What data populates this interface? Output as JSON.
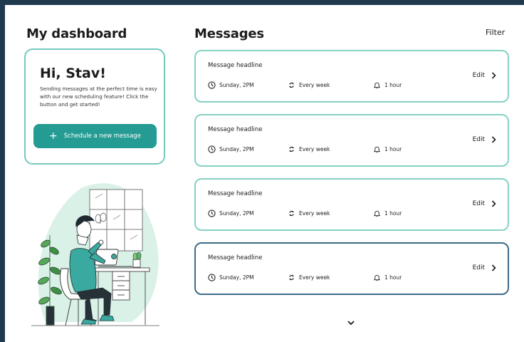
{
  "header": {
    "title": "My dashboard",
    "messages_title": "Messages",
    "filter_label": "Filter"
  },
  "welcome": {
    "greeting": "Hi, Stav!",
    "description": "Sending messages at the perfect time is easy with our new scheduling feature! Click the button and get started!",
    "button_label": "Schedule a new message",
    "button_icon": "plus-icon"
  },
  "messages": [
    {
      "headline": "Message headline",
      "day": "Sunday, 2PM",
      "frequency": "Every week",
      "reminder": "1 hour",
      "edit_label": "Edit"
    },
    {
      "headline": "Message headline",
      "day": "Sunday, 2PM",
      "frequency": "Every week",
      "reminder": "1 hour",
      "edit_label": "Edit"
    },
    {
      "headline": "Message headline",
      "day": "Sunday, 2PM",
      "frequency": "Every week",
      "reminder": "1 hour",
      "edit_label": "Edit"
    },
    {
      "headline": "Message headline",
      "day": "Sunday, 2PM",
      "frequency": "Every week",
      "reminder": "1 hour",
      "edit_label": "Edit"
    }
  ],
  "icons": {
    "time": "clock-icon",
    "frequency": "repeat-icon",
    "reminder": "bell-icon",
    "edit": "chevron-right-icon",
    "more": "chevron-down-icon"
  },
  "colors": {
    "primary": "#259c93",
    "card_border": "#86d1c5",
    "selected_border": "#3e6b87",
    "background": "#1f3a4d",
    "illustration_blob": "#d9f1e7"
  }
}
